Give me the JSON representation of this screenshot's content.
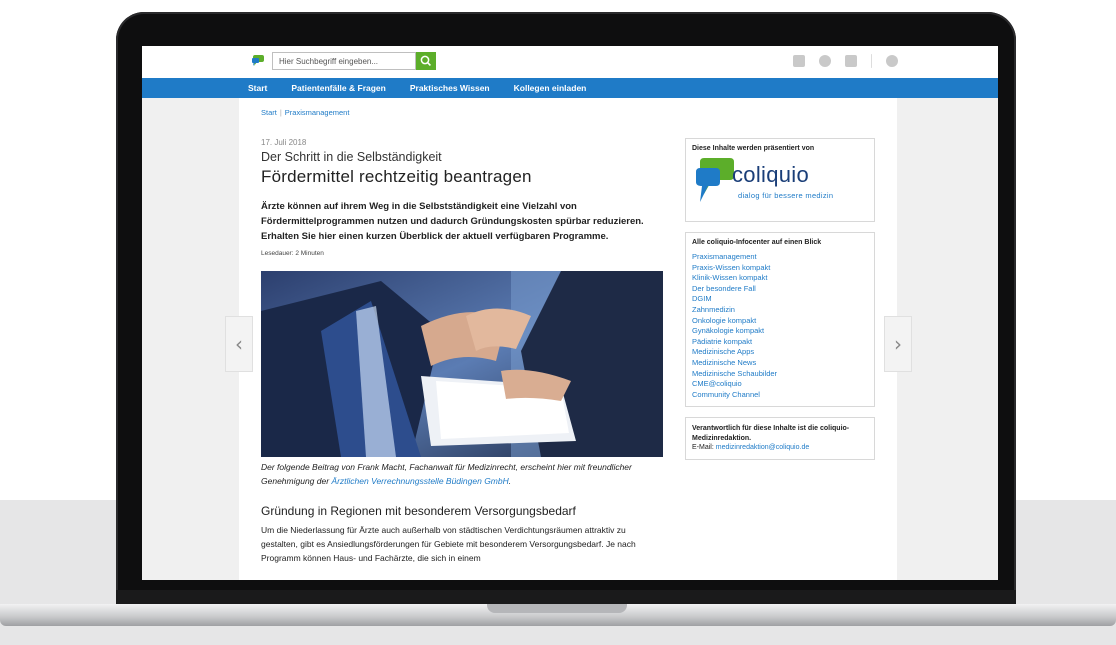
{
  "search": {
    "placeholder": "Hier Suchbegriff eingeben..."
  },
  "top_icons": [
    "mail-icon",
    "globe-icon",
    "users-icon",
    "gear-icon"
  ],
  "nav": {
    "items": [
      "Start",
      "Patientenfälle & Fragen",
      "Praktisches Wissen",
      "Kollegen einladen"
    ]
  },
  "breadcrumb": {
    "home": "Start",
    "separator": "|",
    "current": "Praxismanagement"
  },
  "article": {
    "date": "17. Juli 2018",
    "kicker": "Der Schritt in die Selbständigkeit",
    "headline": "Fördermittel rechtzeitig beantragen",
    "lead": "Ärzte können auf ihrem Weg in die Selbstständigkeit eine Vielzahl von Fördermittelprogrammen nutzen und dadurch Gründungskosten spürbar reduzieren. Erhalten Sie hier einen kurzen Überblick der aktuell verfügbaren Programme.",
    "read_time": "Lesedauer: 2 Minuten",
    "caption_prefix": "Der folgende Beitrag von Frank Macht, Fachanwalt für Medizinrecht, erscheint hier mit freundlicher Genehmigung der ",
    "caption_link": "Ärztlichen Verrechnungsstelle Büdingen GmbH",
    "caption_suffix": ".",
    "section_heading": "Gründung in Regionen mit besonderem Versorgungsbedarf",
    "section_text": "Um die Niederlassung für Ärzte auch außerhalb von städtischen Verdichtungsräumen attraktiv zu gestalten, gibt es Ansiedlungsförderungen für Gebiete mit besonderem Versorgungsbedarf. Je nach Programm können Haus- und Fachärzte, die sich in einem"
  },
  "sidebar": {
    "sponsor_title": "Diese Inhalte werden präsentiert von",
    "sponsor_name": "coliquio",
    "sponsor_tagline": "dialog für bessere medizin",
    "infocenter_title": "Alle coliquio-Infocenter auf einen Blick",
    "infocenter_links": [
      "Praxismanagement",
      "Praxis-Wissen kompakt",
      "Klinik-Wissen kompakt",
      "Der besondere Fall",
      "DGIM",
      "Zahnmedizin",
      "Onkologie kompakt",
      "Gynäkologie kompakt",
      "Pädiatrie kompakt",
      "Medizinische Apps",
      "Medizinische News",
      "Medizinische Schaubilder",
      "CME@coliquio",
      "Community Channel"
    ],
    "responsible_text": "Verantwortlich für diese Inhalte ist die coliquio-Medizinredaktion.",
    "email_label": "E-Mail:",
    "email": "medizinredaktion@coliquio.de"
  },
  "carousel": {
    "prev": "‹",
    "next": "›"
  },
  "colors": {
    "nav_blue": "#1f7bc7",
    "search_green": "#5cae2a",
    "logo_navy": "#1a3e78"
  }
}
